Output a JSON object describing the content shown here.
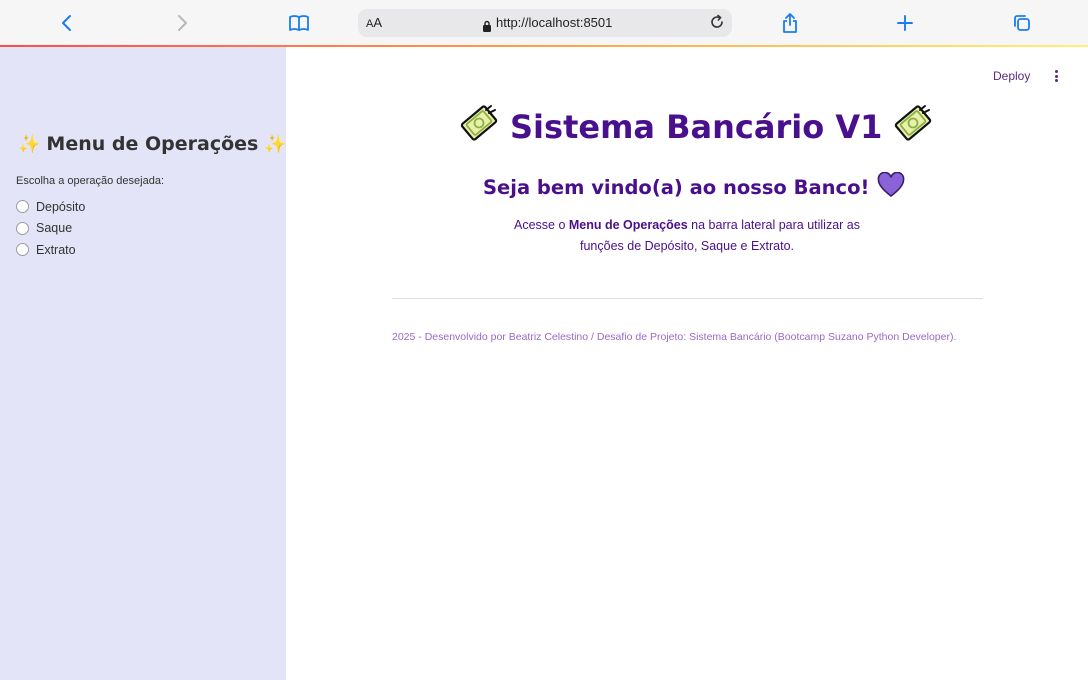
{
  "browser": {
    "text_size_label_small": "A",
    "text_size_label_big": "A",
    "url": "http://localhost:8501",
    "icons": [
      "back-icon",
      "forward-icon",
      "book-icon",
      "lock-icon",
      "reload-icon",
      "share-icon",
      "plus-icon",
      "tabs-icon"
    ]
  },
  "sidebar": {
    "title_left_emoji": "✨",
    "title": "Menu de Operações",
    "title_right_emoji": "✨",
    "radio_label": "Escolha a operação desejada:",
    "options": [
      "Depósito",
      "Saque",
      "Extrato"
    ]
  },
  "header": {
    "deploy_label": "Deploy"
  },
  "main": {
    "title": "Sistema Bancário V1",
    "subtitle": "Seja bem vindo(a) ao nosso Banco!",
    "subtitle_emoji": "💜",
    "intro_pre": "Acesse o ",
    "intro_bold": "Menu de Operações",
    "intro_post": " na barra lateral para utilizar as funções de Depósito, Saque e Extrato.",
    "footer": "2025 - Desenvolvido por Beatriz Celestino / Desafio de Projeto: Sistema Bancário (Bootcamp Suzano Python Developer)."
  },
  "colors": {
    "sidebar_bg": "#e4e4f8",
    "title_purple": "#4a0f8c",
    "footer_purple": "#9a69c4",
    "accent_line": "#ff4b4b"
  }
}
